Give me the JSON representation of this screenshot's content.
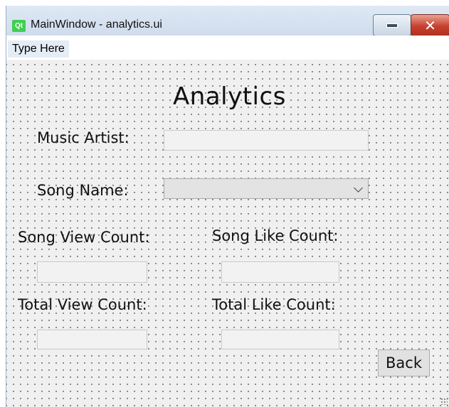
{
  "window": {
    "logo_text": "Qt",
    "title": "MainWindow - analytics.ui",
    "close_glyph": "✕"
  },
  "menubar": {
    "type_here": "Type Here"
  },
  "form": {
    "heading": "Analytics",
    "music_artist_label": "Music Artist:",
    "music_artist_value": "",
    "song_name_label": "Song Name:",
    "song_name_value": "",
    "song_view_count_label": "Song View Count:",
    "song_view_count_value": "",
    "song_like_count_label": "Song Like Count:",
    "song_like_count_value": "",
    "total_view_count_label": "Total View Count:",
    "total_view_count_value": "",
    "total_like_count_label": "Total Like Count:",
    "total_like_count_value": "",
    "back_label": "Back"
  }
}
